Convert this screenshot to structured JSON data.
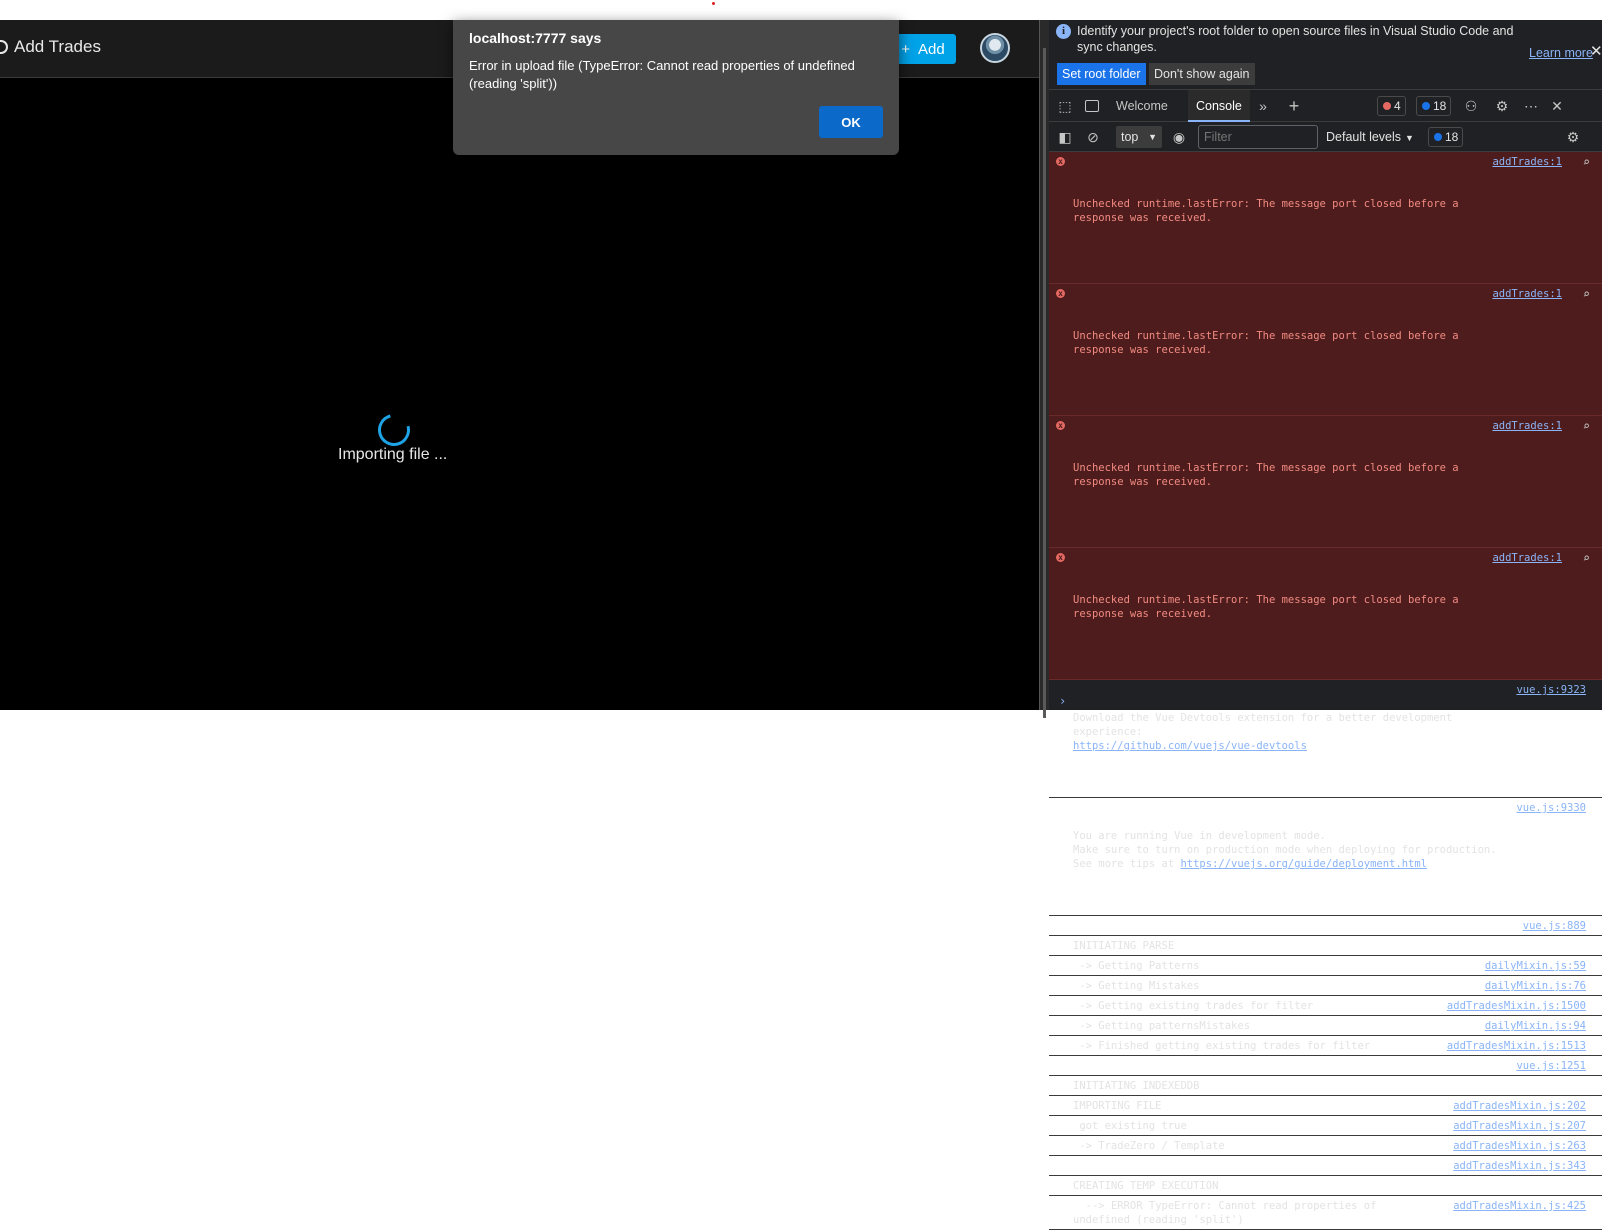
{
  "app": {
    "title": "Add Trades",
    "add_button_label": "Add",
    "loading_text": "Importing file ..."
  },
  "dialog": {
    "title": "localhost:7777 says",
    "message": "Error in upload file (TypeError: Cannot read properties of undefined (reading 'split'))",
    "ok_label": "OK"
  },
  "devtools": {
    "infobar": {
      "text": "Identify your project's root folder to open source files in Visual Studio Code and sync changes.",
      "learn_more": "Learn more",
      "set_root_label": "Set root folder",
      "dont_show_label": "Don't show again"
    },
    "tabs": {
      "welcome": "Welcome",
      "console": "Console"
    },
    "error_count": "4",
    "message_count": "18",
    "filter": {
      "context": "top",
      "placeholder": "Filter",
      "levels": "Default levels",
      "issues_count": "18"
    },
    "colors": {
      "error_bg": "#4e1c1c",
      "error_text": "#f28b82",
      "link": "#8ab4f8",
      "accent": "#1a73e8"
    },
    "console": {
      "errors": [
        {
          "text": "Unchecked runtime.lastError: The message port closed before a response was received.",
          "source": "addTrades:1"
        },
        {
          "text": "Unchecked runtime.lastError: The message port closed before a response was received.",
          "source": "addTrades:1"
        },
        {
          "text": "Unchecked runtime.lastError: The message port closed before a response was received.",
          "source": "addTrades:1"
        },
        {
          "text": "Unchecked runtime.lastError: The message port closed before a response was received.",
          "source": "addTrades:1"
        }
      ],
      "vue_devtools": {
        "text": "Download the Vue Devtools extension for a better development experience:",
        "link": "https://github.com/vuejs/vue-devtools",
        "source": "vue.js:9323"
      },
      "vue_mode": {
        "text": "You are running Vue in development mode.\nMake sure to turn on production mode when deploying for production.\nSee more tips at ",
        "link": "https://vuejs.org/guide/deployment.html",
        "source": "vue.js:9330"
      },
      "logs": [
        {
          "source": "vue.js:889",
          "text": ""
        },
        {
          "source": "",
          "text": "INITIATING PARSE"
        },
        {
          "source": "dailyMixin.js:59",
          "text": " -> Getting Patterns"
        },
        {
          "source": "dailyMixin.js:76",
          "text": " -> Getting Mistakes"
        },
        {
          "source": "addTradesMixin.js:1500",
          "text": " -> Getting existing trades for filter"
        },
        {
          "source": "dailyMixin.js:94",
          "text": " -> Getting patternsMistakes"
        },
        {
          "source": "addTradesMixin.js:1513",
          "text": " -> Finished getting existing trades for filter"
        },
        {
          "source": "vue.js:1251",
          "text": ""
        },
        {
          "source": "",
          "text": "INITIATING INDEXEDDB"
        },
        {
          "source": "addTradesMixin.js:202",
          "text": "IMPORTING FILE"
        },
        {
          "source": "addTradesMixin.js:207",
          "text": " got existing true"
        },
        {
          "source": "addTradesMixin.js:263",
          "text": " -> TradeZero / Template"
        },
        {
          "source": "addTradesMixin.js:343",
          "text": ""
        },
        {
          "source": "",
          "text": "CREATING TEMP EXECUTION"
        },
        {
          "source": "addTradesMixin.js:425",
          "text": "  --> ERROR TypeError: Cannot read properties of undefined (reading 'split')"
        }
      ]
    }
  }
}
